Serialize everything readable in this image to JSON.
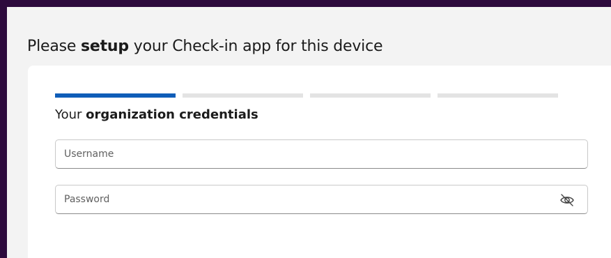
{
  "header": {
    "prefix": "Please ",
    "emphasis": "setup",
    "suffix": " your Check-in app for this device"
  },
  "progress": {
    "total_steps": 4,
    "current_step": 1
  },
  "form": {
    "section_prefix": "Your ",
    "section_emphasis": "organization credentials",
    "username_placeholder": "Username",
    "password_placeholder": "Password",
    "password_toggle_icon": "eye-slash-icon"
  },
  "colors": {
    "accent": "#0f5db8",
    "background": "#f3f3f3",
    "frame": "#2d0a3d"
  }
}
